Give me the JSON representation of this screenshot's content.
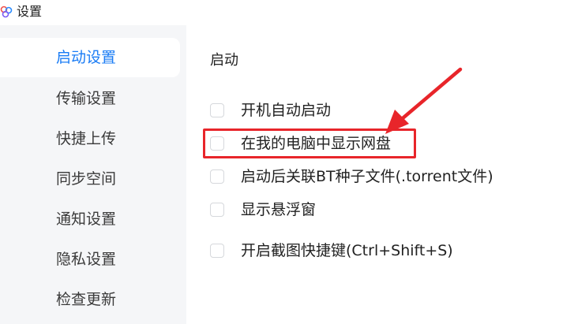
{
  "window": {
    "title": "设置",
    "app_icon": "app-logo-icon"
  },
  "sidebar": {
    "items": [
      {
        "label": "启动设置",
        "active": true
      },
      {
        "label": "传输设置",
        "active": false
      },
      {
        "label": "快捷上传",
        "active": false
      },
      {
        "label": "同步空间",
        "active": false
      },
      {
        "label": "通知设置",
        "active": false
      },
      {
        "label": "隐私设置",
        "active": false
      },
      {
        "label": "检查更新",
        "active": false
      }
    ]
  },
  "content": {
    "section_title": "启动",
    "options": [
      {
        "label": "开机自动启动",
        "checked": false
      },
      {
        "label": "在我的电脑中显示网盘",
        "checked": false,
        "annotated": true
      },
      {
        "label": "启动后关联BT种子文件(.torrent文件)",
        "checked": false
      },
      {
        "label": "显示悬浮窗",
        "checked": false
      },
      {
        "label": "开启截图快捷键(Ctrl+Shift+S)",
        "checked": false
      }
    ]
  },
  "colors": {
    "accent": "#1a7cf5",
    "sidebar_bg": "#f5f6f8",
    "annotation": "#e8252a"
  }
}
